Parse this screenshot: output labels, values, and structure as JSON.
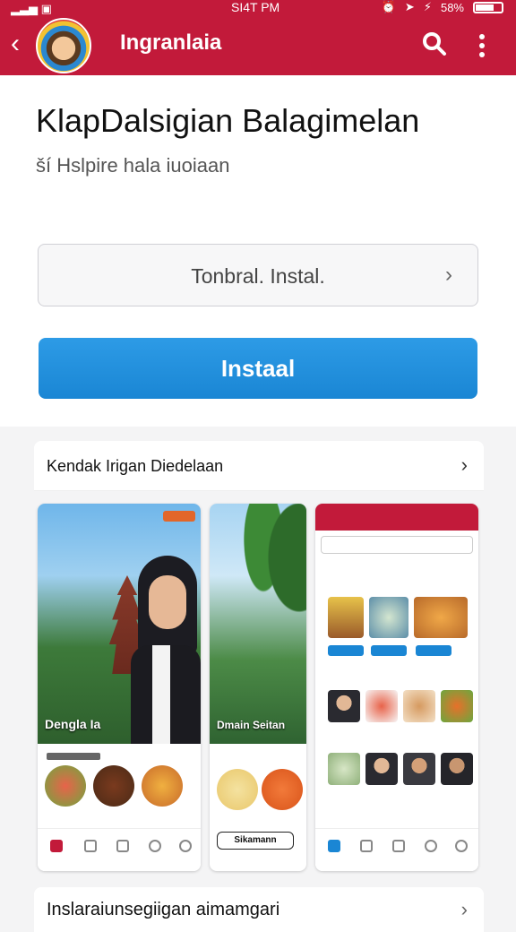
{
  "status": {
    "time": "SI4T PM",
    "battery": "58%"
  },
  "appbar": {
    "title": "Ingranlaia"
  },
  "header": {
    "title": "KlapDalsigian Balagimelan",
    "subtitle": "ší Hslpire hala iuoiaan"
  },
  "select": {
    "value": "Tonbral. Instal."
  },
  "install": {
    "label": "Instaal"
  },
  "section": {
    "label": "Kendak Irigan Diedelaan"
  },
  "screenshots": {
    "shot1_title": "Dengla Ia",
    "shot2_title": "Dmain Seitan",
    "chip": "Sikamann"
  },
  "section2": {
    "label": "Inslaraiunsegiigan aimamgari"
  }
}
